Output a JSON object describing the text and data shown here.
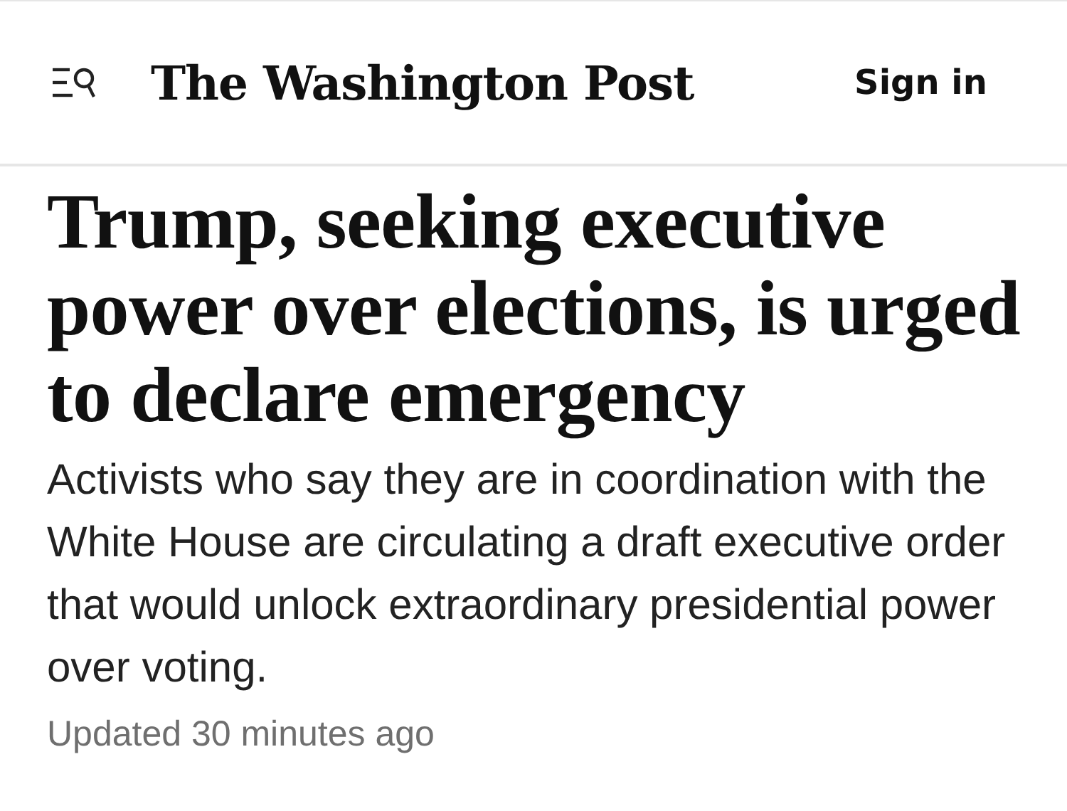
{
  "header": {
    "logo": "The Washington Post",
    "sign_in": "Sign in"
  },
  "article": {
    "headline": "Trump, seeking executive power over elections, is urged to declare emergency",
    "summary": "Activists who say they are in coordination with the White House are circulating a draft executive order that would unlock extraordinary presidential power over voting.",
    "updated": "Updated 30 minutes ago"
  }
}
